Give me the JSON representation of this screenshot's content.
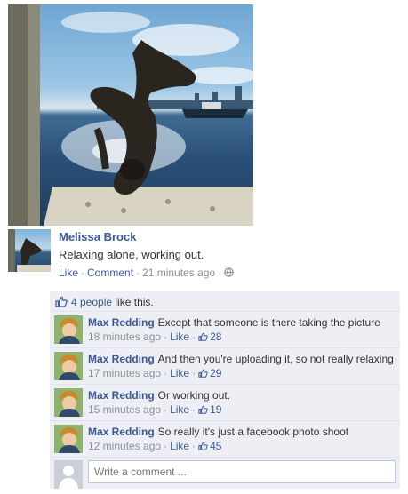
{
  "post": {
    "author": "Melissa Brock",
    "status": "Relaxing alone, working out.",
    "like_label": "Like",
    "comment_label": "Comment",
    "time": "21 minutes ago",
    "sep": "·"
  },
  "likes_summary": "4 people",
  "likes_suffix": "like this.",
  "comments": [
    {
      "name": "Max Redding",
      "text": "Except that someone is there taking the picture",
      "time": "18 minutes ago",
      "like_label": "Like",
      "like_count": "28"
    },
    {
      "name": "Max Redding",
      "text": "And then you're uploading it, so not really relaxing",
      "time": "17 minutes ago",
      "like_label": "Like",
      "like_count": "29"
    },
    {
      "name": "Max Redding",
      "text": "Or working out.",
      "time": "15 minutes ago",
      "like_label": "Like",
      "like_count": "19"
    },
    {
      "name": "Max Redding",
      "text": "So really it's just a facebook photo shoot",
      "time": "12 minutes ago",
      "like_label": "Like",
      "like_count": "45"
    }
  ],
  "write_comment": {
    "placeholder": "Write a comment ..."
  },
  "colors": {
    "link": "#3b5998",
    "ufi_bg": "#edeff4",
    "meta": "#8a8f99"
  },
  "icons": {
    "privacy": "globe-icon",
    "like": "thumbs-up-icon"
  }
}
